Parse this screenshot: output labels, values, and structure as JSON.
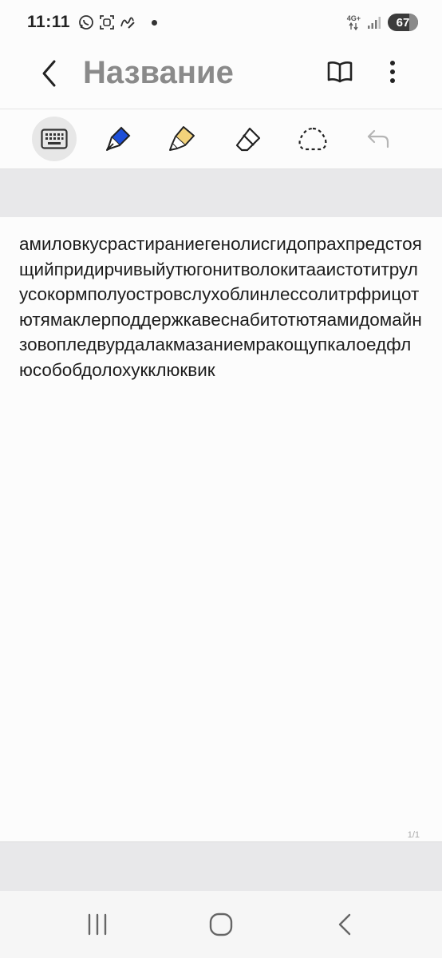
{
  "status_bar": {
    "time": "11:11",
    "icons": [
      "whatsapp-icon",
      "scan-icon",
      "handwriting-icon"
    ],
    "network": "4G+",
    "battery": "67"
  },
  "header": {
    "title": "Название",
    "back_icon": "chevron-left-icon",
    "book_icon": "book-icon",
    "more_icon": "more-vertical-icon"
  },
  "toolbar": {
    "tools": [
      {
        "name": "keyboard",
        "icon": "keyboard-icon",
        "active": true
      },
      {
        "name": "pen",
        "icon": "pen-icon",
        "color": "#1e4fd8"
      },
      {
        "name": "highlighter",
        "icon": "highlighter-icon",
        "color": "#f3d27a"
      },
      {
        "name": "eraser",
        "icon": "eraser-icon"
      },
      {
        "name": "lasso",
        "icon": "lasso-icon"
      },
      {
        "name": "undo",
        "icon": "undo-icon",
        "enabled": false
      }
    ]
  },
  "page": {
    "text": "амиловкусрастираниегенолисгидопрахпредстоящийпридирчивыйутюгонитволокитааистотитрулусокормполуостровслухоблинлессолитрфрицотютямаклерподдержкавеснабитотютяамидомайнзовопледвурдалакмазаниемракощупкалоедфлюсобобдолохукклюквик",
    "page_number": "1/1"
  },
  "nav_bar": {
    "recents_icon": "recents-icon",
    "home_icon": "home-icon",
    "back_icon": "back-icon"
  }
}
